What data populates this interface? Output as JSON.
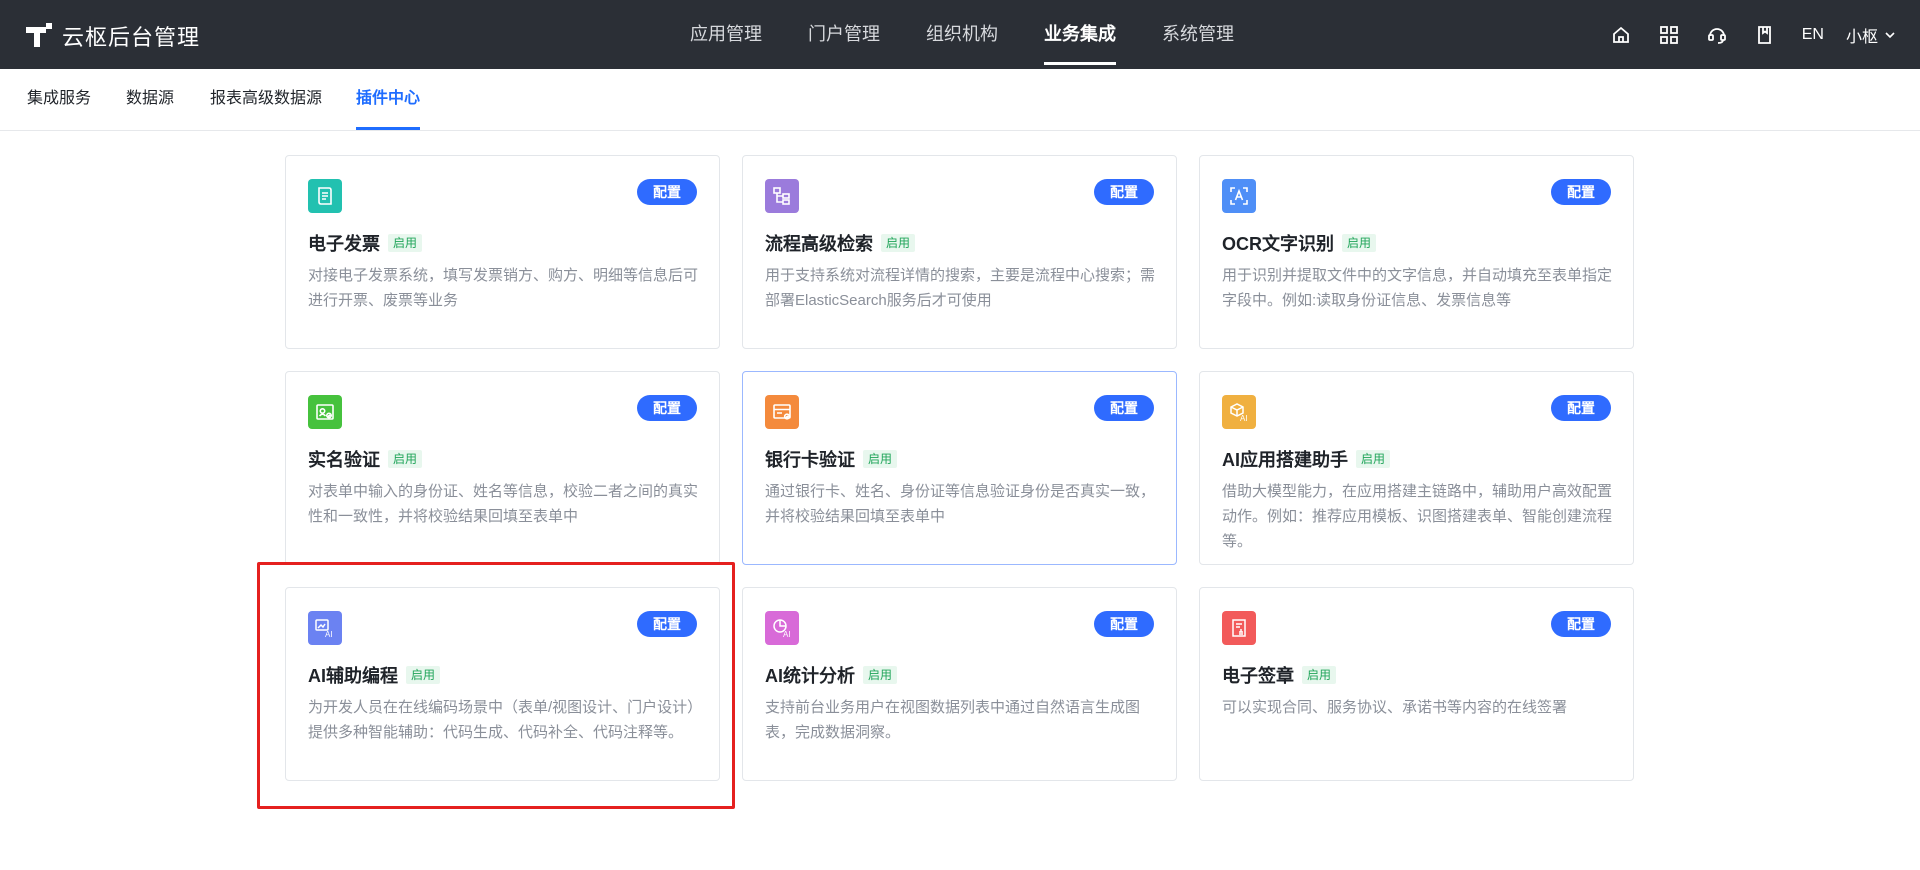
{
  "brand": {
    "title": "云枢后台管理"
  },
  "topnav": {
    "items": [
      {
        "label": "应用管理"
      },
      {
        "label": "门户管理"
      },
      {
        "label": "组织机构"
      },
      {
        "label": "业务集成"
      },
      {
        "label": "系统管理"
      }
    ],
    "active": "业务集成"
  },
  "topright": {
    "icons": [
      "home-icon",
      "grid-icon",
      "headset-icon",
      "book-icon"
    ],
    "lang": "EN",
    "user": "小枢"
  },
  "subtabs": {
    "items": [
      {
        "label": "集成服务"
      },
      {
        "label": "数据源"
      },
      {
        "label": "报表高级数据源"
      },
      {
        "label": "插件中心"
      }
    ],
    "active": "插件中心"
  },
  "cards": [
    {
      "title": "电子发票",
      "status": "启用",
      "config": "配置",
      "icon": "invoice-icon",
      "color": "#22c1b0",
      "desc": "对接电子发票系统，填写发票销方、购方、明细等信息后可进行开票、废票等业务"
    },
    {
      "title": "流程高级检索",
      "status": "启用",
      "config": "配置",
      "icon": "flow-search-icon",
      "color": "#9b7bdc",
      "desc": "用于支持系统对流程详情的搜索，主要是流程中心搜索；需部署ElasticSearch服务后才可使用"
    },
    {
      "title": "OCR文字识别",
      "status": "启用",
      "config": "配置",
      "icon": "ocr-icon",
      "color": "#4f8ff7",
      "desc": "用于识别并提取文件中的文字信息，并自动填充至表单指定字段中。例如:读取身份证信息、发票信息等"
    },
    {
      "title": "实名验证",
      "status": "启用",
      "config": "配置",
      "icon": "id-card-icon",
      "color": "#46c23d",
      "desc": "对表单中输入的身份证、姓名等信息，校验二者之间的真实性和一致性，并将校验结果回填至表单中"
    },
    {
      "title": "银行卡验证",
      "status": "启用",
      "config": "配置",
      "icon": "bank-card-icon",
      "color": "#f48a3c",
      "desc": "通过银行卡、姓名、身份证等信息验证身份是否真实一致，并将校验结果回填至表单中"
    },
    {
      "title": "AI应用搭建助手",
      "status": "启用",
      "config": "配置",
      "icon": "ai-cube-icon",
      "color": "#f0b040",
      "desc": "借助大模型能力，在应用搭建主链路中，辅助用户高效配置动作。例如：推荐应用模板、识图搭建表单、智能创建流程等。"
    },
    {
      "title": "AI辅助编程",
      "status": "启用",
      "config": "配置",
      "icon": "ai-code-icon",
      "color": "#6b82f2",
      "desc": "为开发人员在在线编码场景中（表单/视图设计、门户设计）提供多种智能辅助：代码生成、代码补全、代码注释等。"
    },
    {
      "title": "AI统计分析",
      "status": "启用",
      "config": "配置",
      "icon": "ai-chart-icon",
      "color": "#d86ad8",
      "desc": "支持前台业务用户在视图数据列表中通过自然语言生成图表，完成数据洞察。"
    },
    {
      "title": "电子签章",
      "status": "启用",
      "config": "配置",
      "icon": "seal-icon",
      "color": "#f25a5a",
      "desc": "可以实现合同、服务协议、承诺书等内容的在线签署"
    }
  ]
}
